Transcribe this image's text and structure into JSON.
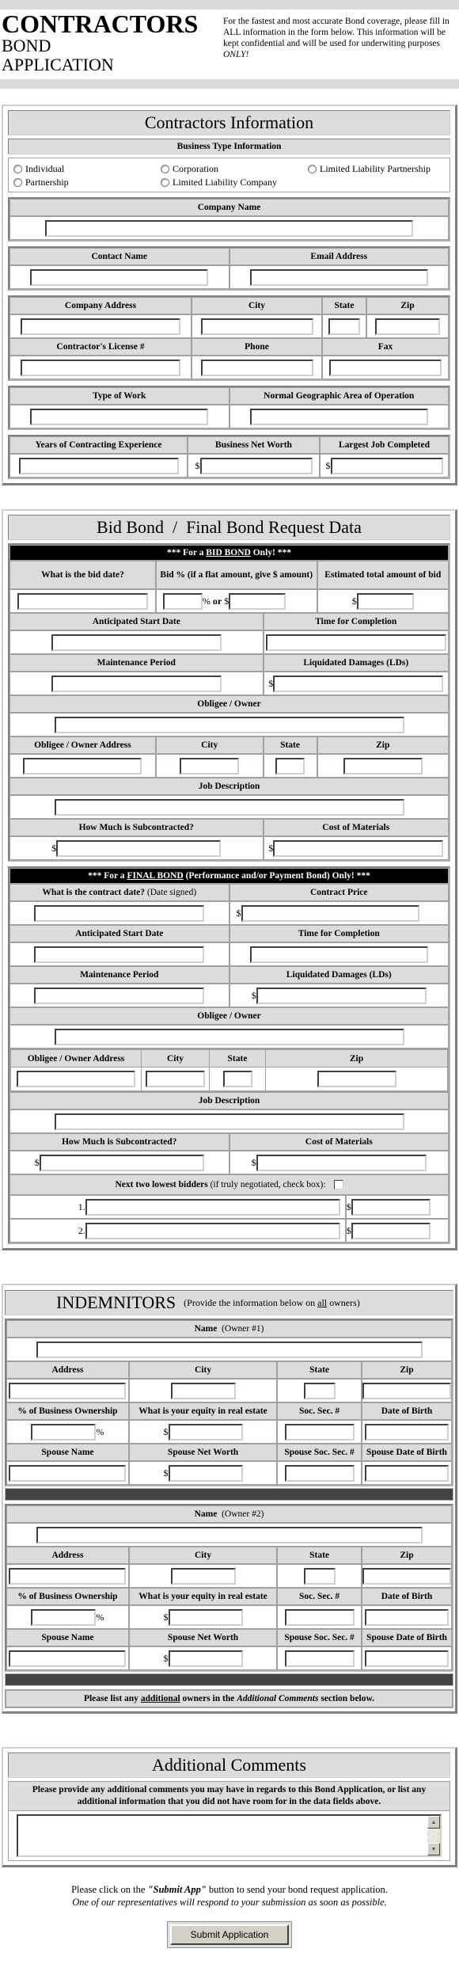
{
  "header": {
    "title_line1": "CONTRACTORS",
    "title_line2": "BOND",
    "title_line3": "APPLICATION",
    "intro_text": "For the fastest and most accurate Bond coverage, please fill in ALL information in the form below. This information will be kept confidential and will be used for underwiting purposes ",
    "intro_emphasis": "ONLY!"
  },
  "contractors": {
    "title": "Contractors Information",
    "business_type_label": "Business Type Information",
    "business_types": [
      "Individual",
      "Corporation",
      "Limited Liability Partnership",
      "Partnership",
      "Limited Liability Company"
    ],
    "company_name": "Company Name",
    "contact_name": "Contact Name",
    "email_address": "Email Address",
    "company_address": "Company Address",
    "city": "City",
    "state": "State",
    "zip": "Zip",
    "license": "Contractor's License #",
    "phone": "Phone",
    "fax": "Fax",
    "type_of_work": "Type of Work",
    "geo_area": "Normal Geographic Area of Operation",
    "years_experience": "Years of Contracting Experience",
    "net_worth": "Business Net Worth",
    "largest_job": "Largest Job Completed",
    "currency": "$"
  },
  "bond": {
    "title": "Bid Bond  /  Final Bond Request Data",
    "bid_banner_pre": "*** For a ",
    "bid_banner_u": "BID BOND",
    "bid_banner_post": " Only! ***",
    "bid_date": "What is the bid date?",
    "bid_pct": "Bid % (if a flat amount, give $ amount)",
    "est_total": "Estimated total amount of bid",
    "pct_sign": "%",
    "or": "or",
    "currency": "$",
    "start_date": "Anticipated Start Date",
    "time_completion": "Time for Completion",
    "maintenance": "Maintenance Period",
    "lds": "Liquidated Damages (LDs)",
    "obligee": "Obligee / Owner",
    "obligee_address": "Obligee / Owner Address",
    "city": "City",
    "state": "State",
    "zip": "Zip",
    "job_description": "Job Description",
    "subcontracted": "How Much is Subcontracted?",
    "materials": "Cost of Materials",
    "final_banner_pre": "*** For a ",
    "final_banner_u": "FINAL BOND",
    "final_banner_post": " (Performance and/or Payment Bond) Only! ***",
    "contract_date": "What is the contract date?",
    "contract_date_note": " (Date signed)",
    "contract_price": "Contract Price",
    "bidders_label": "Next two lowest bidders",
    "bidders_note": " (if truly negotiated, check box):",
    "bidder_numbers": [
      "1.",
      "2."
    ]
  },
  "indemnitors": {
    "title": "INDEMNITORS",
    "subtitle_pre": "(Provide the information below on ",
    "subtitle_u": "all",
    "subtitle_post": " owners)",
    "owners": [
      {
        "name_label": "Name",
        "owner_tag": "(Owner #1)"
      },
      {
        "name_label": "Name",
        "owner_tag": "(Owner #2)"
      }
    ],
    "address": "Address",
    "city": "City",
    "state": "State",
    "zip": "Zip",
    "ownership_pct": "% of Business Ownership",
    "equity": "What is your equity in real estate",
    "ssn": "Soc. Sec. #",
    "dob": "Date of Birth",
    "spouse_name": "Spouse Name",
    "spouse_net_worth": "Spouse Net Worth",
    "spouse_ssn": "Spouse Soc. Sec. #",
    "spouse_dob": "Spouse Date of Birth",
    "pct_sign": "%",
    "currency": "$",
    "note_pre": "Please list any ",
    "note_u": "additional",
    "note_mid": " owners in the ",
    "note_i": "Additional Comments",
    "note_post": " section below."
  },
  "comments": {
    "title": "Additional Comments",
    "instructions": "Please provide any additional comments you may have in regards to this Bond Application, or list any additional information that you did not have room for in the data fields above.",
    "value": ""
  },
  "footer": {
    "line1_pre": "Please click on the ",
    "line1_bold": "\"Submit App\"",
    "line1_post": " button to send your bond request application.",
    "line2": "One of our representatives will respond to your submission as soon as possible.",
    "submit_label": "Submit Application"
  }
}
